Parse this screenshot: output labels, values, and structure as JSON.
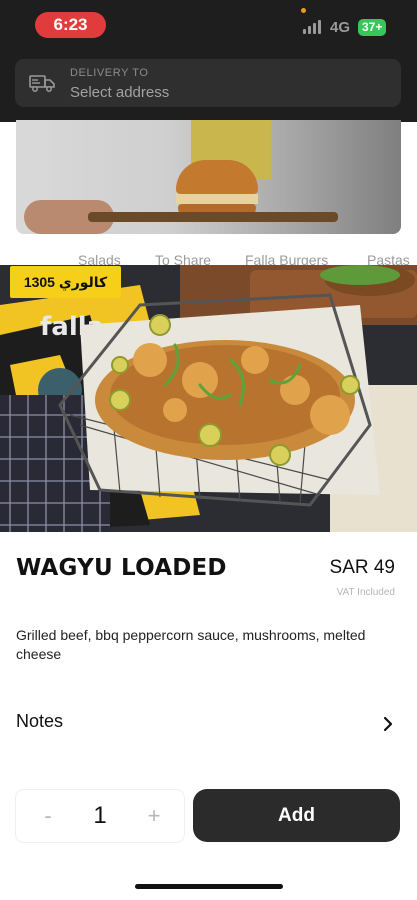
{
  "status_bar": {
    "time": "6:23",
    "network": "4G",
    "battery": "37+"
  },
  "delivery": {
    "label": "DELIVERY TO",
    "placeholder": "Select address"
  },
  "background_tabs": [
    "Salads",
    "To Share",
    "Falla Burgers",
    "Pastas"
  ],
  "product": {
    "calories": "1305 كالوري",
    "name": "WAGYU LOADED",
    "price": "SAR 49",
    "vat_note": "VAT Included",
    "description": "Grilled beef, bbq peppercorn sauce, mushrooms, melted cheese"
  },
  "notes": {
    "label": "Notes"
  },
  "quantity": {
    "minus": "-",
    "value": "1",
    "plus": "+"
  },
  "actions": {
    "add_label": "Add"
  },
  "colors": {
    "header": "#1e1e1e",
    "calorie_badge": "#f6d018",
    "add_button": "#2b2b2b",
    "time_pill": "#e23b3b"
  }
}
